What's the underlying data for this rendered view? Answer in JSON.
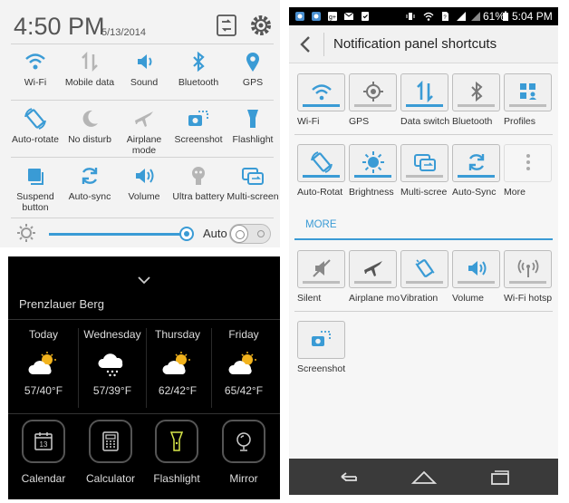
{
  "left_quick_settings": {
    "time": "4:50 PM",
    "date": "5/13/2014",
    "header_icons": [
      "rotate-settings-icon",
      "gear-icon"
    ],
    "tiles": [
      {
        "label": "Wi-Fi",
        "icon": "wifi-icon",
        "active": true
      },
      {
        "label": "Mobile data",
        "icon": "mobile-data-icon",
        "active": false
      },
      {
        "label": "Sound",
        "icon": "sound-icon",
        "active": true
      },
      {
        "label": "Bluetooth",
        "icon": "bluetooth-icon",
        "active": true
      },
      {
        "label": "GPS",
        "icon": "gps-icon",
        "active": true
      },
      {
        "label": "Auto-rotate",
        "icon": "auto-rotate-icon",
        "active": true
      },
      {
        "label": "No disturb",
        "icon": "moon-icon",
        "active": false
      },
      {
        "label": "Airplane mode",
        "icon": "airplane-icon",
        "active": false
      },
      {
        "label": "Screenshot",
        "icon": "screenshot-icon",
        "active": true
      },
      {
        "label": "Flashlight",
        "icon": "flashlight-icon",
        "active": true
      },
      {
        "label": "Suspend button",
        "icon": "suspend-button-icon",
        "active": true
      },
      {
        "label": "Auto-sync",
        "icon": "sync-icon",
        "active": true
      },
      {
        "label": "Volume",
        "icon": "volume-icon",
        "active": true
      },
      {
        "label": "Ultra battery",
        "icon": "ultra-battery-icon",
        "active": false
      },
      {
        "label": "Multi-screen",
        "icon": "multi-screen-icon",
        "active": true
      }
    ],
    "brightness": {
      "auto_label": "Auto",
      "level": 0.97,
      "auto_enabled": false
    }
  },
  "left_widget": {
    "location": "Prenzlauer Berg",
    "forecast": [
      {
        "day": "Today",
        "temps": "57/40°F",
        "icon": "partly-cloudy-icon"
      },
      {
        "day": "Wednesday",
        "temps": "57/39°F",
        "icon": "snow-cloud-icon"
      },
      {
        "day": "Thursday",
        "temps": "62/42°F",
        "icon": "partly-cloudy-icon"
      },
      {
        "day": "Friday",
        "temps": "65/42°F",
        "icon": "partly-cloudy-icon"
      }
    ],
    "apps": [
      {
        "label": "Calendar",
        "icon": "calendar-icon",
        "badge": "13"
      },
      {
        "label": "Calculator",
        "icon": "calculator-icon"
      },
      {
        "label": "Flashlight",
        "icon": "flashlight-icon"
      },
      {
        "label": "Mirror",
        "icon": "mirror-icon"
      }
    ]
  },
  "right_panel": {
    "status_bar": {
      "battery": "61%",
      "time": "5:04 PM"
    },
    "title": "Notification panel shortcuts",
    "row1": [
      {
        "label": "Wi-Fi",
        "icon": "wifi-icon",
        "active": true
      },
      {
        "label": "GPS",
        "icon": "gps-icon",
        "active": false
      },
      {
        "label": "Data switch",
        "icon": "data-switch-icon",
        "active": true
      },
      {
        "label": "Bluetooth",
        "icon": "bluetooth-icon",
        "active": false
      },
      {
        "label": "Profiles",
        "icon": "profiles-icon",
        "active": false
      }
    ],
    "row2": [
      {
        "label": "Auto-Rotat",
        "icon": "auto-rotate-icon",
        "active": true
      },
      {
        "label": "Brightness",
        "icon": "brightness-icon",
        "active": true
      },
      {
        "label": "Multi-scree",
        "icon": "multi-screen-icon",
        "active": false
      },
      {
        "label": "Auto-Sync",
        "icon": "sync-icon",
        "active": true
      },
      {
        "label": "More",
        "icon": "more-icon",
        "active": false
      }
    ],
    "more_header": "MORE",
    "row3": [
      {
        "label": "Silent",
        "icon": "silent-icon",
        "active": false
      },
      {
        "label": "Airplane mo",
        "icon": "airplane-icon",
        "active": false
      },
      {
        "label": "Vibration",
        "icon": "vibration-icon",
        "active": false
      },
      {
        "label": "Volume",
        "icon": "volume-icon",
        "active": false
      },
      {
        "label": "Wi-Fi hotsp",
        "icon": "hotspot-icon",
        "active": false
      }
    ],
    "row4": [
      {
        "label": "Screenshot",
        "icon": "screenshot-icon",
        "active": false
      }
    ],
    "nav": [
      "back-icon",
      "home-icon",
      "recent-apps-icon"
    ]
  },
  "colors": {
    "accent": "#3a9bd5",
    "panel_bg": "#f3f3f3",
    "widget_bg": "#000000",
    "icon_grey": "#9a9a9a"
  }
}
